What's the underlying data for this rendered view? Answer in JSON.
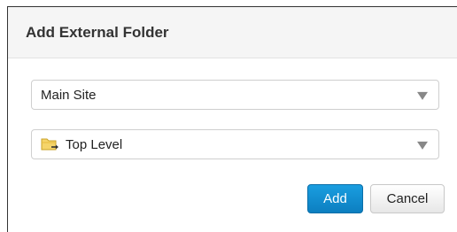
{
  "dialog": {
    "title": "Add External Folder"
  },
  "site_select": {
    "value": "Main Site"
  },
  "folder_select": {
    "value": "Top Level",
    "icon": "folder-arrow-icon"
  },
  "buttons": {
    "add_label": "Add",
    "cancel_label": "Cancel"
  },
  "colors": {
    "primary": "#1a9ee0",
    "header_bg": "#f5f5f5"
  }
}
